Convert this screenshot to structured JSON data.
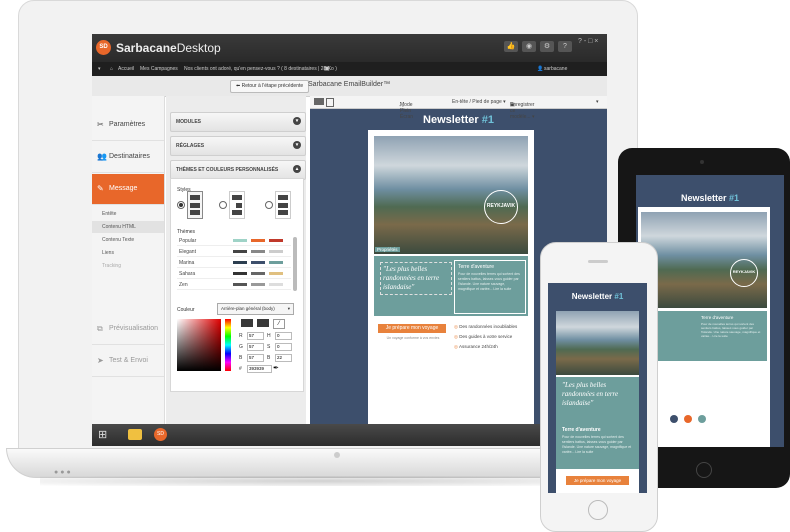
{
  "app": {
    "name_bold": "Sarbacane",
    "name_rest": "Desktop",
    "logo_text": "SD",
    "window_controls": "? - □ ×",
    "builder_title": "Sarbacane EmailBuilder™",
    "back_button": "Retour à l'étape précédente"
  },
  "nav": {
    "home": "Accueil",
    "campaigns": "Mes Campagnes",
    "campaign_title": "Nos clients ont adoré, qu'en pensez-vous ? ( 8 destinataires | 28 Ko )",
    "user": "sarbacane"
  },
  "sidebar": {
    "items": [
      {
        "icon": "✂",
        "label": "Paramètres"
      },
      {
        "icon": "👥",
        "label": "Destinataires"
      },
      {
        "icon": "✎",
        "label": "Message"
      },
      {
        "icon": "⧉",
        "label": "Prévisualisation"
      },
      {
        "icon": "➤",
        "label": "Test & Envoi"
      }
    ],
    "subitems": [
      "Entête",
      "Contenu HTML",
      "Contenu Texte",
      "Liens",
      "Tracking"
    ]
  },
  "panel": {
    "modules": "MODULES",
    "reglages": "RÉGLAGES",
    "themes": "THÈMES ET COULEURS PERSONNALISÉS",
    "styles_label": "Styles",
    "themes_label": "Thèmes",
    "themes_list": [
      {
        "name": "Popular",
        "colors": [
          "#9fd3c7",
          "#e8672a",
          "#c0392b"
        ]
      },
      {
        "name": "Elegant",
        "colors": [
          "#444444",
          "#888888",
          "#cccccc"
        ]
      },
      {
        "name": "Marina",
        "colors": [
          "#2c3e50",
          "#3d4f6c",
          "#6d9e9c"
        ]
      },
      {
        "name": "Sahara",
        "colors": [
          "#333333",
          "#666666",
          "#e0c080"
        ]
      },
      {
        "name": "Zen",
        "colors": [
          "#555555",
          "#999999",
          "#dddddd"
        ]
      }
    ],
    "couleur_label": "Couleur",
    "couleur_select": "Arrière-plan général (body)",
    "rgb": {
      "r": "57",
      "g": "57",
      "b": "57"
    },
    "hsb": {
      "h": "0",
      "s": "0",
      "b": "22"
    },
    "hex": "393939"
  },
  "canvas": {
    "toolbar_fullscreen": "Mode Plein Écran",
    "toolbar_header": "En-tête / Pied de page ▾",
    "toolbar_save": "Enregistrer ce modèle... ▾",
    "properties": "Propriétés"
  },
  "newsletter": {
    "title": "Newsletter",
    "hash": "#1",
    "badge_top": "Ils",
    "badge_city": "REYKJAVIK",
    "quote": "\"Les plus belles randonnées en terre islandaise\"",
    "box_title": "Terre d'aventure",
    "box_text": "Pour de nouvelles terres qui sortent des sentiers battus, laissez-vous guider par l'Islande. Une nature sauvage, magnifique et variée... Lire la suite",
    "cta": "Je prépare mon voyage",
    "cta_sub": "Un voyage conforme à vos envies",
    "bullets": [
      "Des randonnées inoubliables",
      "Des guides à votre service",
      "Assurance 24h/24h"
    ]
  }
}
